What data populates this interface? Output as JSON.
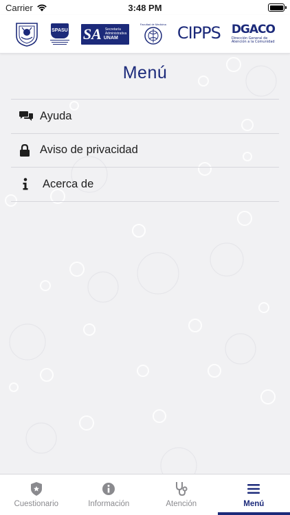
{
  "status_bar": {
    "carrier": "Carrier",
    "time": "3:48 PM"
  },
  "header": {
    "logos": [
      {
        "name": "UNAM shield"
      },
      {
        "name": "SPASU",
        "text": "SPASU"
      },
      {
        "name": "Secretaría Administrativa UNAM",
        "text": "SA",
        "subtitle": "Secretaría Administrativa",
        "caption": "UNAM"
      },
      {
        "name": "Facultad de Medicina",
        "text": "Facultad de Medicina"
      },
      {
        "name": "CIPPS",
        "text": "CIPPS"
      },
      {
        "name": "DGACO",
        "text": "DGACO",
        "subtitle": "Dirección General de",
        "caption": "Atención a la Comunidad"
      }
    ]
  },
  "menu": {
    "title": "Menú",
    "items": [
      {
        "label": "Ayuda",
        "icon": "chat-icon"
      },
      {
        "label": "Aviso de privacidad",
        "icon": "lock-icon"
      },
      {
        "label": "Acerca de",
        "icon": "info-icon"
      }
    ]
  },
  "tabs": [
    {
      "label": "Cuestionario",
      "icon": "badge-icon",
      "active": false
    },
    {
      "label": "Información",
      "icon": "info-circle-icon",
      "active": false
    },
    {
      "label": "Atención",
      "icon": "stethoscope-icon",
      "active": false
    },
    {
      "label": "Menú",
      "icon": "hamburger-icon",
      "active": true
    }
  ],
  "colors": {
    "brand": "#1c2a7a",
    "inactive_tab": "#8a8a8e",
    "background": "#f1f1f3"
  }
}
